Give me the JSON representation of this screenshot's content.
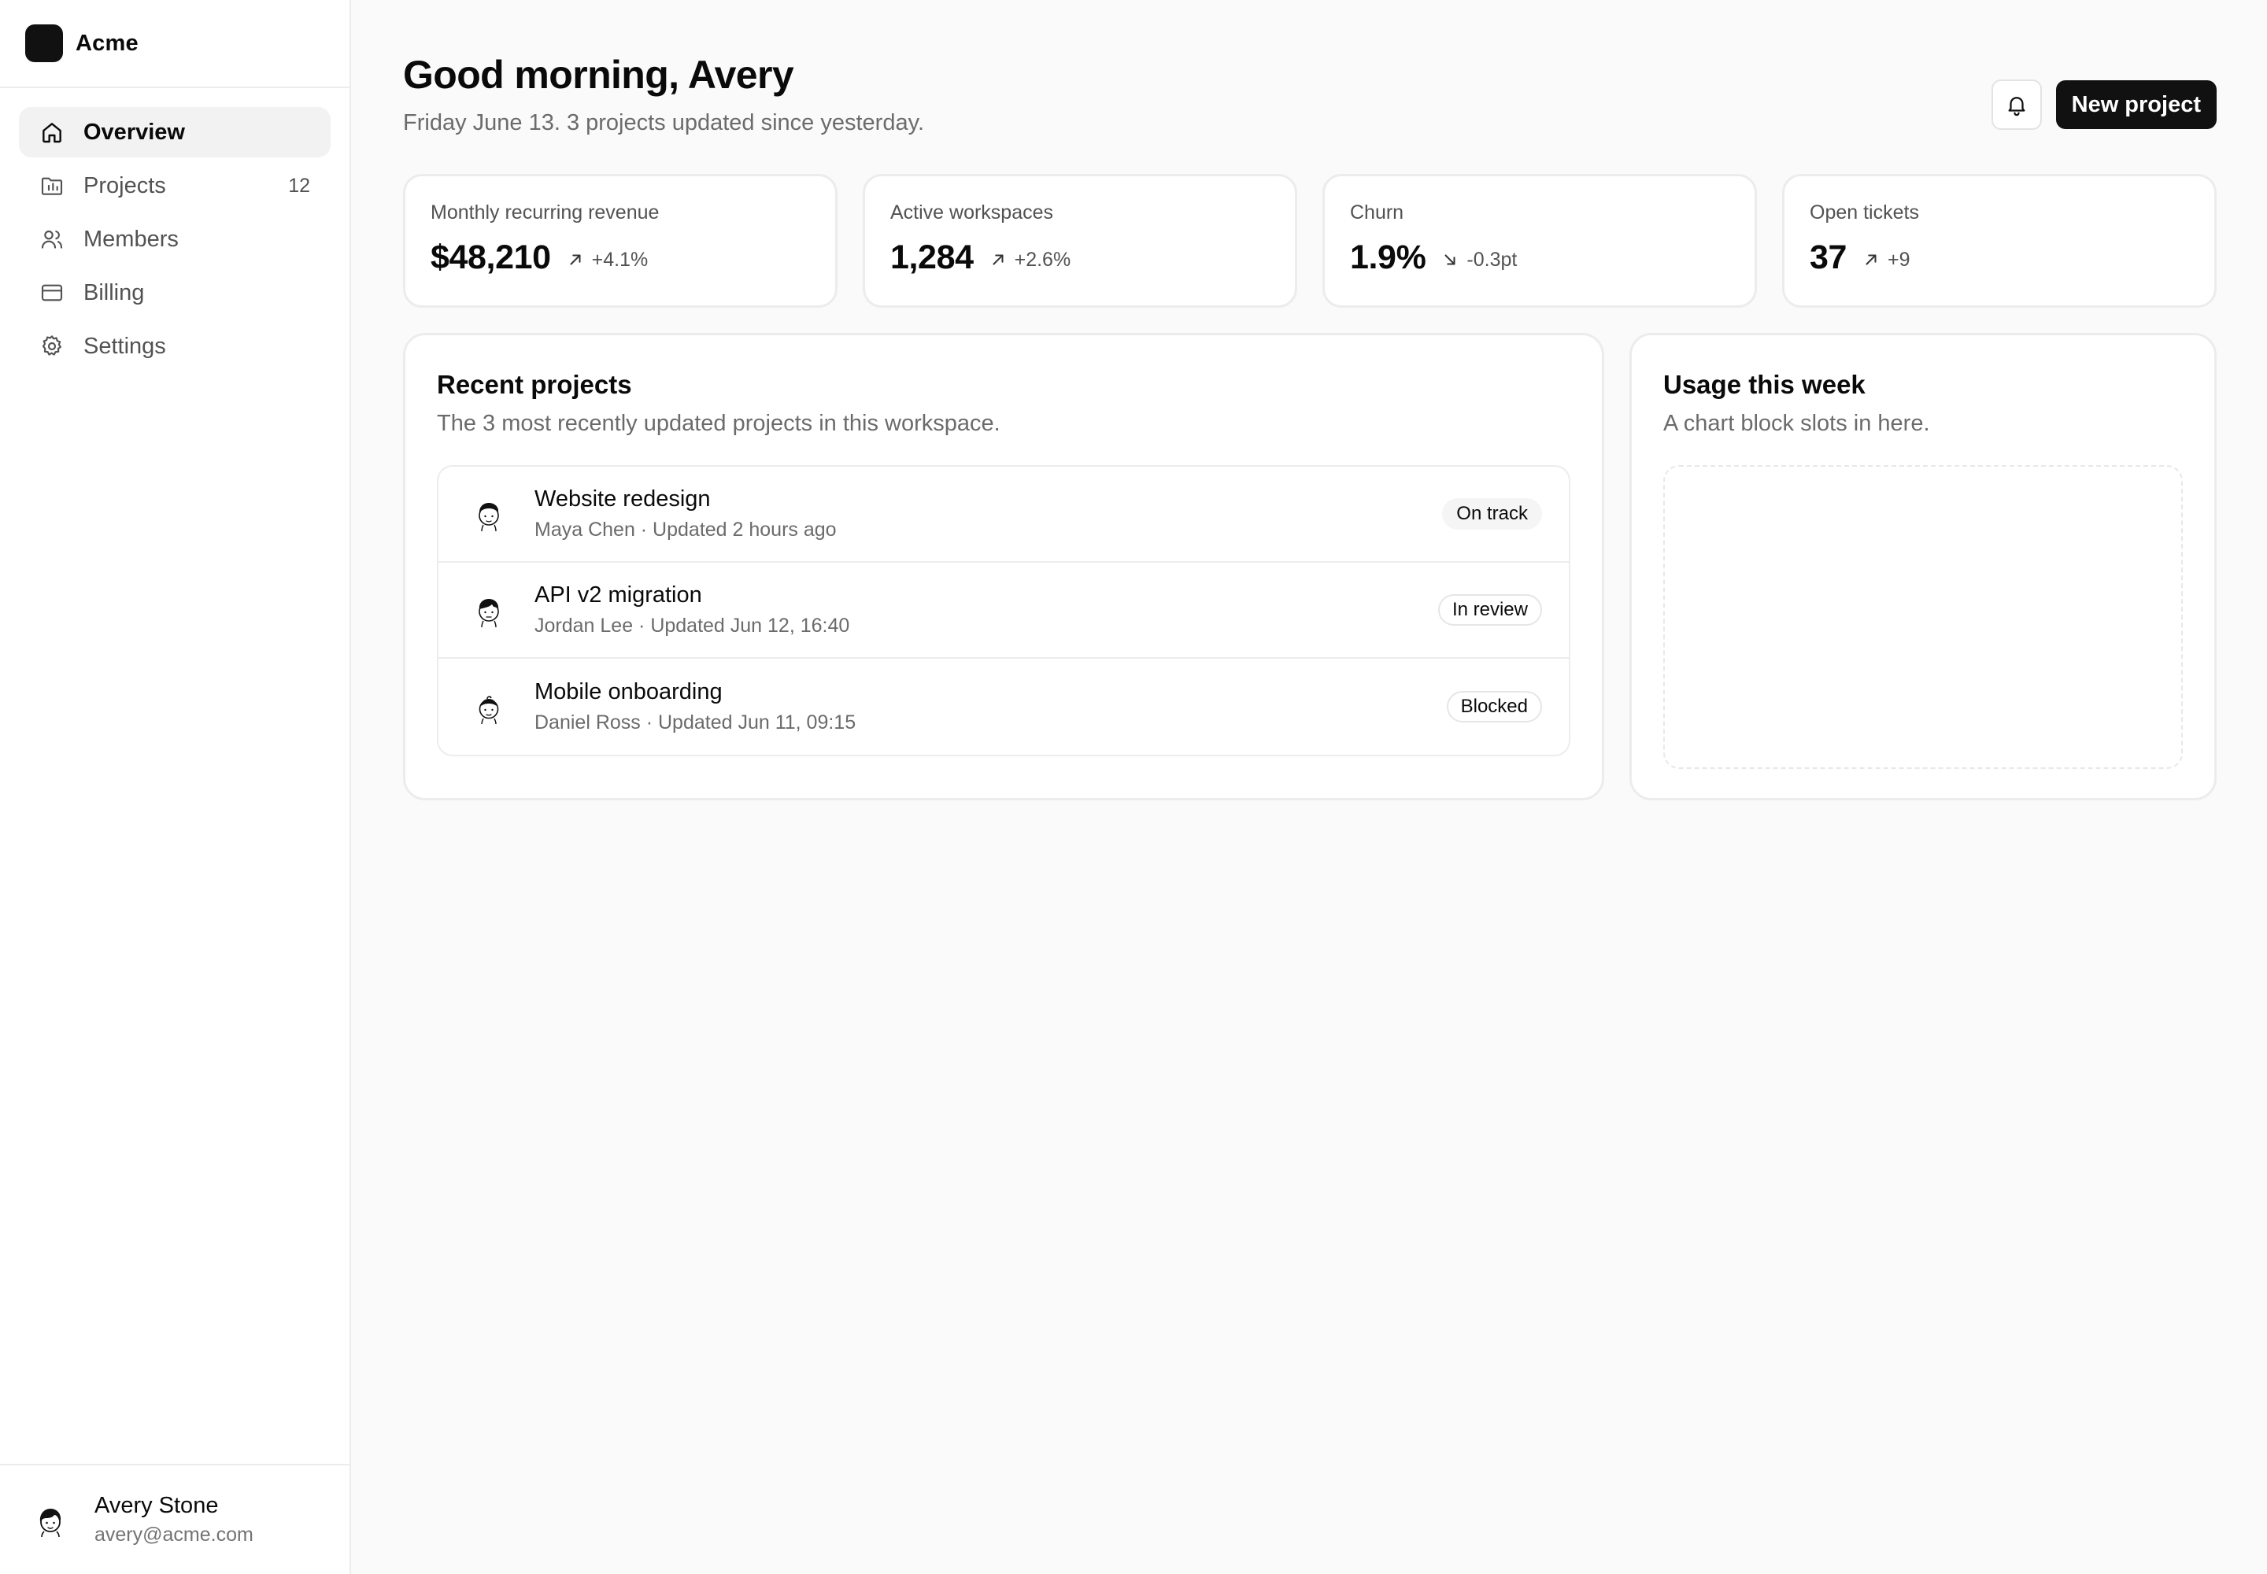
{
  "brand": {
    "name": "Acme"
  },
  "nav": {
    "items": [
      {
        "label": "Overview",
        "icon": "home-icon",
        "active": true
      },
      {
        "label": "Projects",
        "icon": "folder-icon",
        "count": "12"
      },
      {
        "label": "Members",
        "icon": "users-icon"
      },
      {
        "label": "Billing",
        "icon": "credit-card-icon"
      },
      {
        "label": "Settings",
        "icon": "gear-icon"
      }
    ]
  },
  "user": {
    "name": "Avery Stone",
    "email": "avery@acme.com"
  },
  "header": {
    "greeting": "Good morning, Avery",
    "subtitle": "Friday June 13. 3 projects updated since yesterday.",
    "new_project_label": "New project"
  },
  "stats": [
    {
      "label": "Monthly recurring revenue",
      "value": "$48,210",
      "delta": "+4.1%",
      "direction": "up"
    },
    {
      "label": "Active workspaces",
      "value": "1,284",
      "delta": "+2.6%",
      "direction": "up"
    },
    {
      "label": "Churn",
      "value": "1.9%",
      "delta": "-0.3pt",
      "direction": "down"
    },
    {
      "label": "Open tickets",
      "value": "37",
      "delta": "+9",
      "direction": "up"
    }
  ],
  "recent_projects": {
    "title": "Recent projects",
    "description": "The 3 most recently updated projects in this workspace.",
    "rows": [
      {
        "name": "Website redesign",
        "meta": "Maya Chen · Updated 2 hours ago",
        "status": "On track"
      },
      {
        "name": "API v2 migration",
        "meta": "Jordan Lee · Updated Jun 12, 16:40",
        "status": "In review"
      },
      {
        "name": "Mobile onboarding",
        "meta": "Daniel Ross · Updated Jun 11, 09:15",
        "status": "Blocked"
      }
    ]
  },
  "usage": {
    "title": "Usage this week",
    "description": "A chart block slots in here."
  }
}
